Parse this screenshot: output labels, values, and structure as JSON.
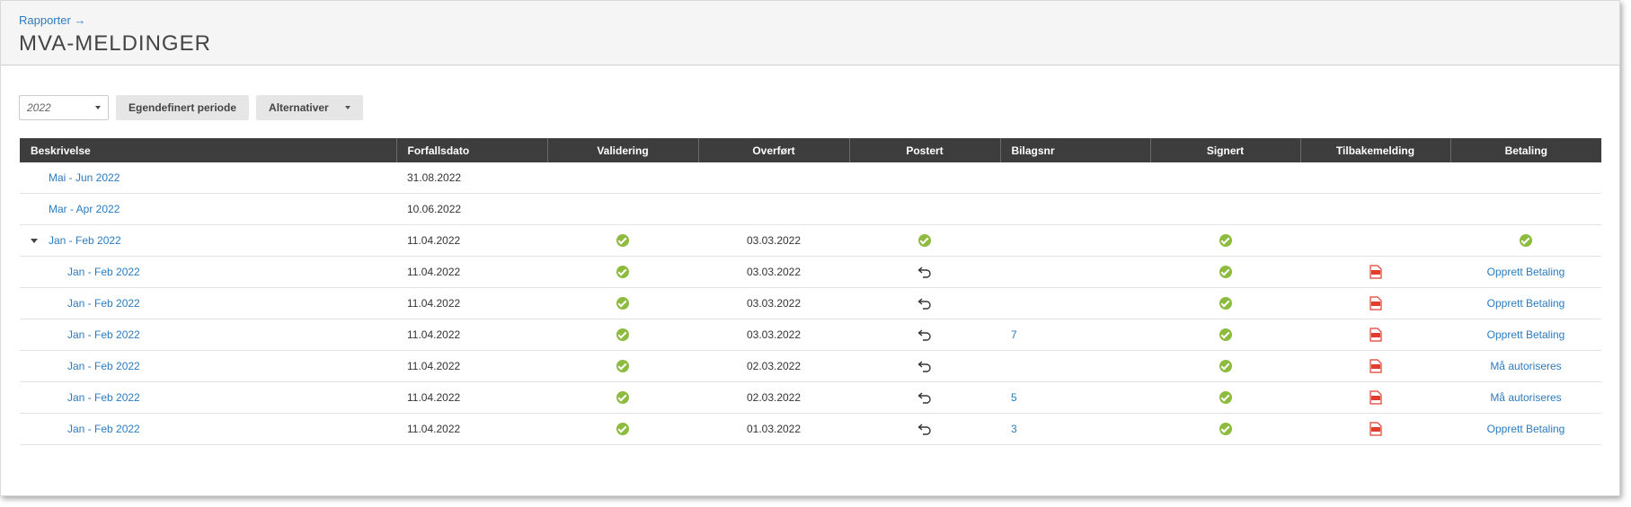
{
  "breadcrumb": {
    "label": "Rapporter →"
  },
  "page": {
    "title": "MVA-MELDINGER"
  },
  "toolbar": {
    "year_value": "2022",
    "custom_period_label": "Egendefinert periode",
    "options_label": "Alternativer"
  },
  "table": {
    "headers": [
      "Beskrivelse",
      "Forfallsdato",
      "Validering",
      "Overført",
      "Postert",
      "Bilagsnr",
      "Signert",
      "Tilbakemelding",
      "Betaling"
    ],
    "rows": [
      {
        "beskrivelse": "Mai - Jun 2022",
        "forfallsdato": "31.08.2022",
        "level": 0
      },
      {
        "beskrivelse": "Mar - Apr 2022",
        "forfallsdato": "10.06.2022",
        "level": 0
      },
      {
        "beskrivelse": "Jan - Feb 2022",
        "forfallsdato": "11.04.2022",
        "overfort": "03.03.2022",
        "level": 0
      },
      {
        "beskrivelse": "Jan - Feb 2022",
        "forfallsdato": "11.04.2022",
        "overfort": "03.03.2022",
        "bilagsnr": "",
        "betaling": "Opprett Betaling",
        "level": 1
      },
      {
        "beskrivelse": "Jan - Feb 2022",
        "forfallsdato": "11.04.2022",
        "overfort": "03.03.2022",
        "bilagsnr": "",
        "betaling": "Opprett Betaling",
        "level": 1
      },
      {
        "beskrivelse": "Jan - Feb 2022",
        "forfallsdato": "11.04.2022",
        "overfort": "03.03.2022",
        "bilagsnr": "7",
        "betaling": "Opprett Betaling",
        "level": 1
      },
      {
        "beskrivelse": "Jan - Feb 2022",
        "forfallsdato": "11.04.2022",
        "overfort": "02.03.2022",
        "bilagsnr": "",
        "betaling": "Må autoriseres",
        "level": 1
      },
      {
        "beskrivelse": "Jan - Feb 2022",
        "forfallsdato": "11.04.2022",
        "overfort": "02.03.2022",
        "bilagsnr": "5",
        "betaling": "Må autoriseres",
        "level": 1
      },
      {
        "beskrivelse": "Jan - Feb 2022",
        "forfallsdato": "11.04.2022",
        "overfort": "01.03.2022",
        "bilagsnr": "3",
        "betaling": "Opprett Betaling",
        "level": 1
      }
    ]
  },
  "icons": {
    "check": "check-circle-icon",
    "undo": "undo-icon",
    "pdf": "pdf-icon",
    "expand": "expand-caret-icon"
  },
  "colors": {
    "link": "#2b7bbf",
    "check": "#8dbb3f",
    "pdf": "#e03c2f",
    "header_bg": "#3d3d3d"
  }
}
